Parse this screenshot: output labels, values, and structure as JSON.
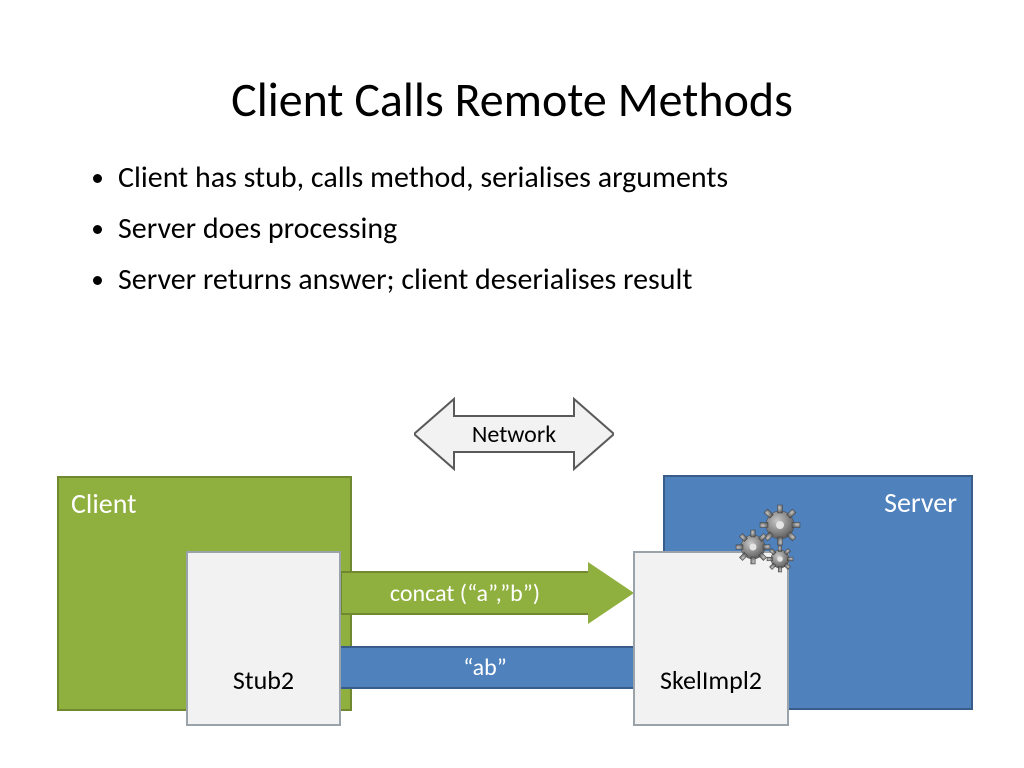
{
  "title": "Client Calls Remote Methods",
  "bullets": [
    "Client has stub, calls method, serialises arguments",
    "Server does processing",
    "Server returns answer; client deserialises result"
  ],
  "diagram": {
    "client_label": "Client",
    "server_label": "Server",
    "stub_label": "Stub2",
    "skel_label": "SkelImpl2",
    "network_label": "Network",
    "call_label": "concat (“a”,”b”)",
    "return_label": "“ab”"
  }
}
